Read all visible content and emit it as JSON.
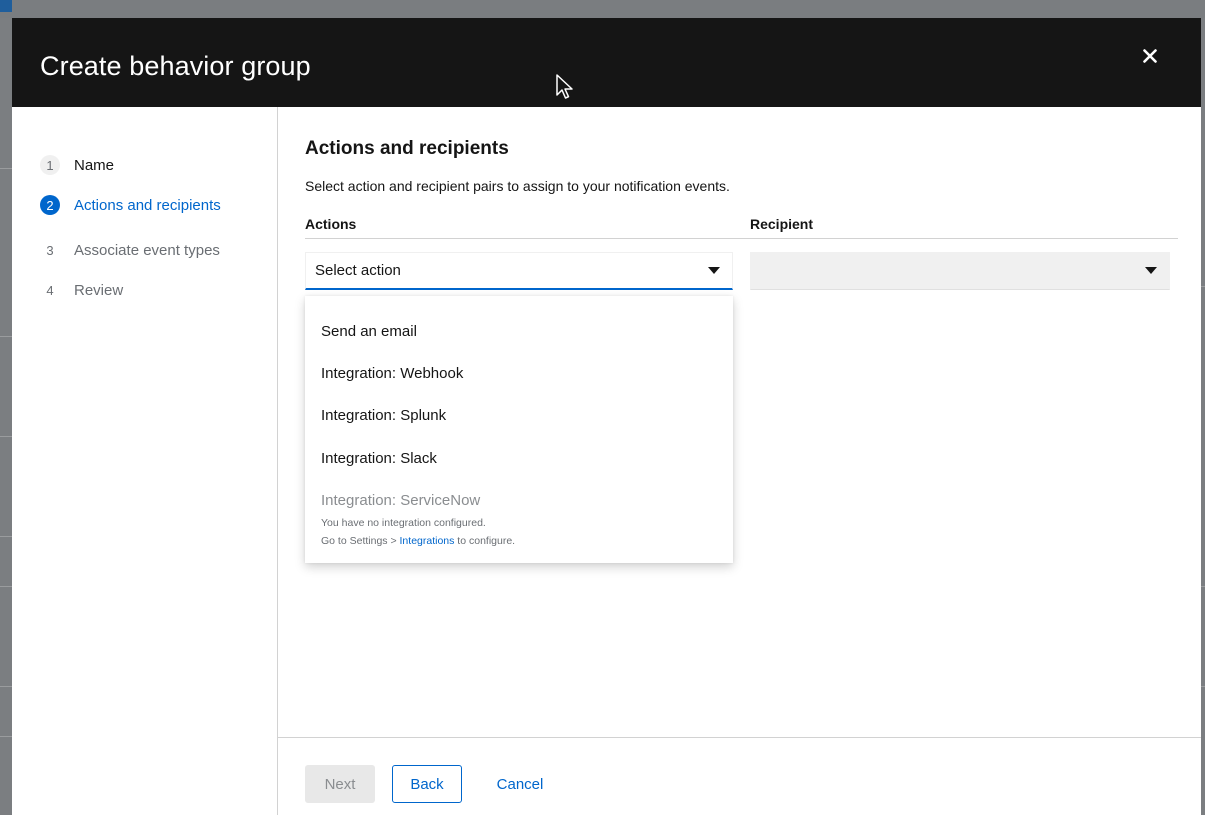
{
  "modal": {
    "title": "Create behavior group"
  },
  "wizard": {
    "steps": [
      {
        "number": "1",
        "label": "Name"
      },
      {
        "number": "2",
        "label": "Actions and recipients"
      },
      {
        "number": "3",
        "label": "Associate event types"
      },
      {
        "number": "4",
        "label": "Review"
      }
    ],
    "current_step": 2
  },
  "main": {
    "title": "Actions and recipients",
    "description": "Select action and recipient pairs to assign to your notification events.",
    "columns": {
      "actions": "Actions",
      "recipient": "Recipient"
    },
    "action_select": {
      "value": "Select action"
    },
    "recipient_select": {
      "value": ""
    },
    "dropdown": {
      "options": [
        {
          "label": "Send an email",
          "enabled": true
        },
        {
          "label": "Integration: Webhook",
          "enabled": true
        },
        {
          "label": "Integration: Splunk",
          "enabled": true
        },
        {
          "label": "Integration: Slack",
          "enabled": true
        },
        {
          "label": "Integration: ServiceNow",
          "enabled": false
        }
      ],
      "note_line1": "You have no integration configured.",
      "note_line2_prefix": "Go to Settings > ",
      "note_line2_link": "Integrations",
      "note_line2_suffix": " to configure."
    }
  },
  "footer": {
    "next": "Next",
    "back": "Back",
    "cancel": "Cancel"
  },
  "colors": {
    "header_bg": "#151515",
    "accent": "#0066cc",
    "muted": "#6a6e73"
  },
  "icons": {
    "close": "close-icon",
    "caret": "caret-down-icon",
    "cursor": "mouse-pointer-icon"
  }
}
